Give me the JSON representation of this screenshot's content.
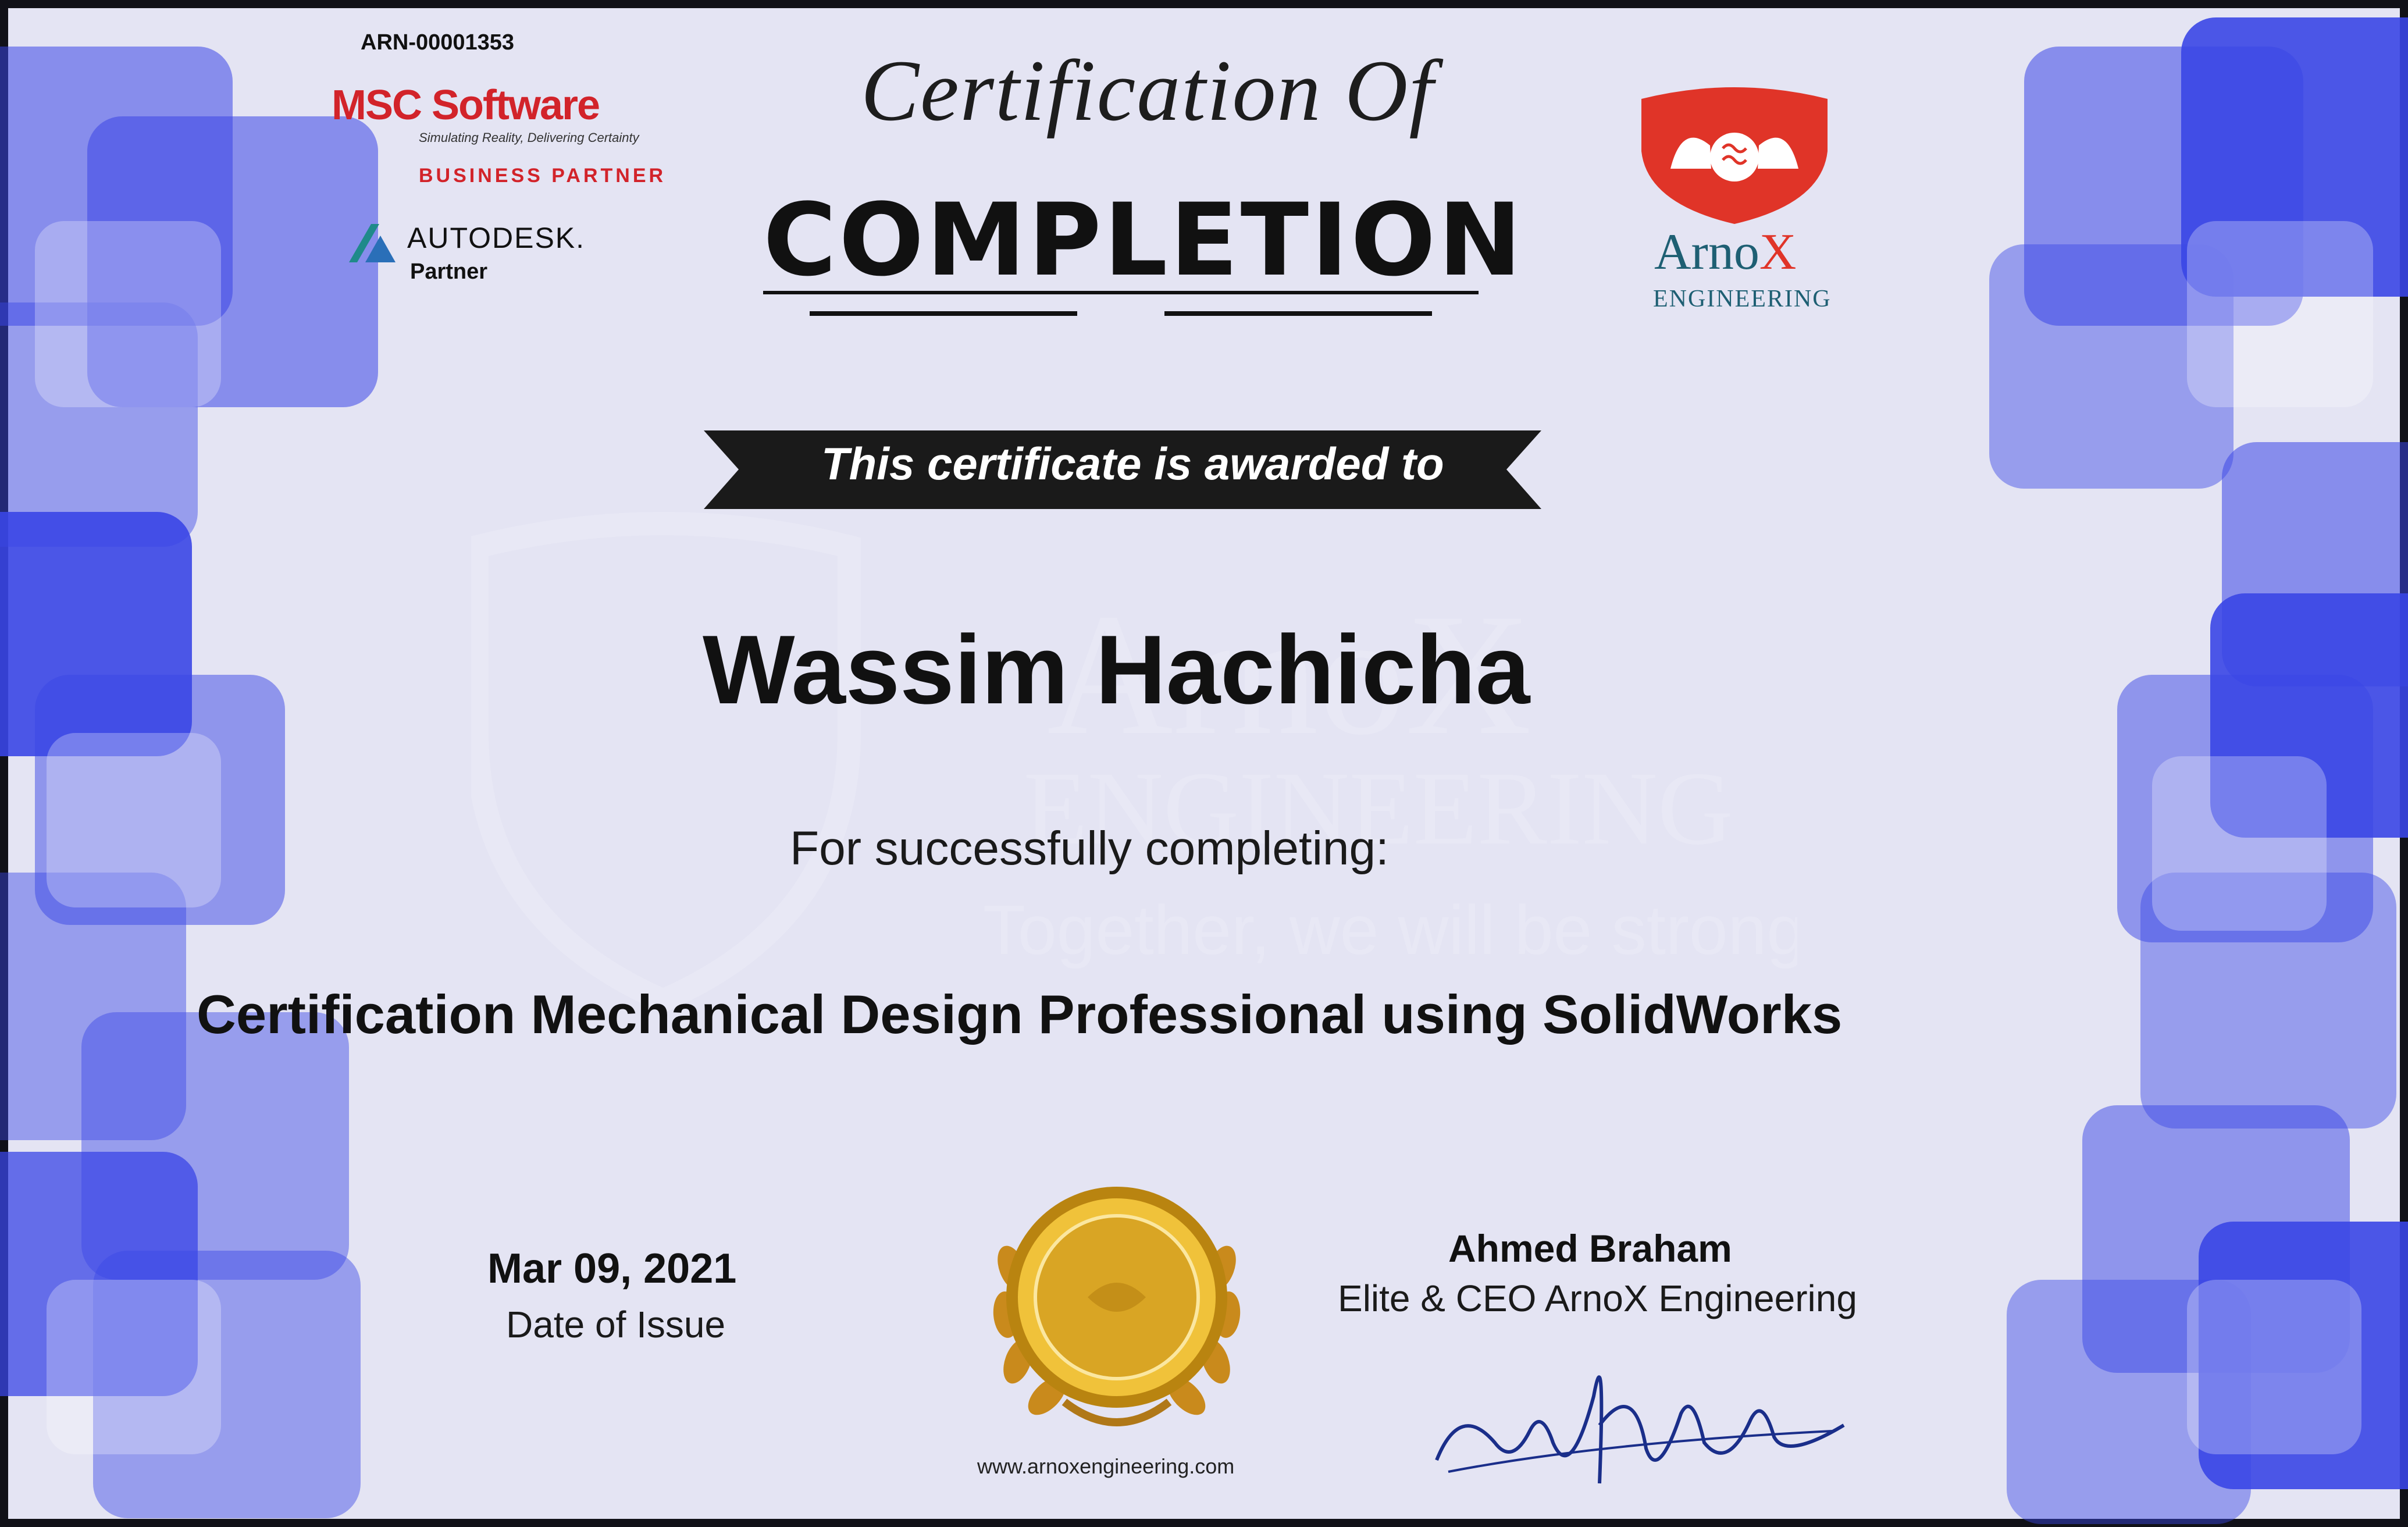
{
  "partners": {
    "arn": "ARN-00001353",
    "msc_brand": "MSC Software",
    "msc_tagline": "Simulating Reality, Delivering Certainty",
    "msc_badge": "BUSINESS PARTNER",
    "autodesk_brand": "AUTODESK.",
    "autodesk_badge": "Partner"
  },
  "header": {
    "title_script": "Certification Of",
    "title_main": "COMPLETION"
  },
  "company_logo": {
    "name_prefix": "Arno",
    "name_suffix": "X",
    "subtitle": "ENGINEERING"
  },
  "ribbon": {
    "text": "This certificate is awarded to"
  },
  "recipient": {
    "name": "Wassim Hachicha"
  },
  "body": {
    "intro": "For successfully completing:",
    "course": "Certification Mechanical Design Professional using SolidWorks"
  },
  "issue": {
    "date": "Mar 09, 2021",
    "label": "Date of Issue"
  },
  "signatory": {
    "name": "Ahmed Braham",
    "title": "Elite & CEO ArnoX Engineering"
  },
  "footer": {
    "website": "www.arnoxengineering.com"
  },
  "watermark": {
    "line1": "ArnoX",
    "line2": "ENGINEERING",
    "line3": "Together, we will be stronger"
  },
  "colors": {
    "background": "#e4e4f3",
    "decor_blue": "#2a35e0",
    "msc_red": "#d2232a",
    "arnox_teal": "#1e5f73",
    "seal_gold": "#d4a21c"
  }
}
